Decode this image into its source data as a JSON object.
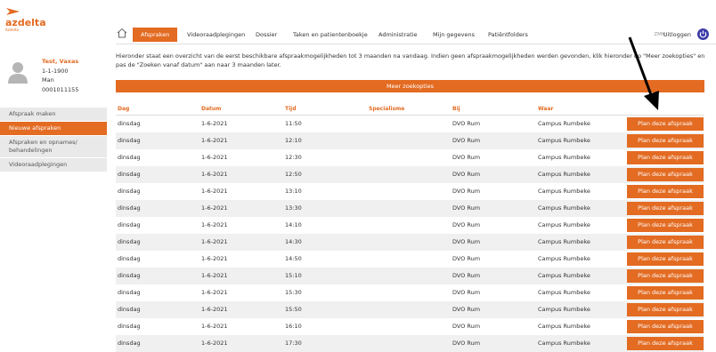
{
  "brand": {
    "name": "azdelta",
    "tagline": "Azdelta",
    "accent": "#e36b22"
  },
  "nav": {
    "items": [
      "Afspraken",
      "Videoraadplegingen",
      "Dossier",
      "Taken en patientenboekje",
      "Administratie",
      "Mijn gegevens",
      "Patiëntfolders"
    ],
    "zmh": "ZMH",
    "logout": "Uitloggen"
  },
  "patient": {
    "name": "Test, Vaxas",
    "dob": "1-1-1900",
    "sex": "Man",
    "id": "0001011155"
  },
  "sidemenu": [
    "Afspraak maken",
    "Nieuwe afspraken",
    "Afspraken en opnames/ behandelingen",
    "Videoraadplegingen"
  ],
  "intro": "Hieronder staat een overzicht van de eerst beschikbare afspraakmogelijkheden tot 3 maanden na vandaag. Indien geen afspraakmogelijkheden werden gevonden, klik hieronder op \"Meer zoekopties\" en pas de \"Zoeken vanaf datum\" aan naar 3 maanden later.",
  "more_options": "Meer zoekopties",
  "table": {
    "headers": [
      "Dag",
      "Datum",
      "Tijd",
      "Specialisme",
      "Bij",
      "Waar"
    ],
    "plan_label": "Plan deze afspraak",
    "rows": [
      [
        "dinsdag",
        "1-6-2021",
        "11:50",
        "",
        "DVO Rum",
        "Campus Rumbeke"
      ],
      [
        "dinsdag",
        "1-6-2021",
        "12:10",
        "",
        "DVO Rum",
        "Campus Rumbeke"
      ],
      [
        "dinsdag",
        "1-6-2021",
        "12:30",
        "",
        "DVO Rum",
        "Campus Rumbeke"
      ],
      [
        "dinsdag",
        "1-6-2021",
        "12:50",
        "",
        "DVO Rum",
        "Campus Rumbeke"
      ],
      [
        "dinsdag",
        "1-6-2021",
        "13:10",
        "",
        "DVO Rum",
        "Campus Rumbeke"
      ],
      [
        "dinsdag",
        "1-6-2021",
        "13:30",
        "",
        "DVO Rum",
        "Campus Rumbeke"
      ],
      [
        "dinsdag",
        "1-6-2021",
        "14:10",
        "",
        "DVO Rum",
        "Campus Rumbeke"
      ],
      [
        "dinsdag",
        "1-6-2021",
        "14:30",
        "",
        "DVO Rum",
        "Campus Rumbeke"
      ],
      [
        "dinsdag",
        "1-6-2021",
        "14:50",
        "",
        "DVO Rum",
        "Campus Rumbeke"
      ],
      [
        "dinsdag",
        "1-6-2021",
        "15:10",
        "",
        "DVO Rum",
        "Campus Rumbeke"
      ],
      [
        "dinsdag",
        "1-6-2021",
        "15:30",
        "",
        "DVO Rum",
        "Campus Rumbeke"
      ],
      [
        "dinsdag",
        "1-6-2021",
        "15:50",
        "",
        "DVO Rum",
        "Campus Rumbeke"
      ],
      [
        "dinsdag",
        "1-6-2021",
        "16:10",
        "",
        "DVO Rum",
        "Campus Rumbeke"
      ],
      [
        "dinsdag",
        "1-6-2021",
        "17:30",
        "",
        "DVO Rum",
        "Campus Rumbeke"
      ]
    ]
  },
  "icons": {
    "home": "home-icon",
    "power": "power-icon",
    "avatar": "avatar-icon",
    "logo": "azdelta-logo-icon",
    "annotation": "arrow-annotation"
  }
}
